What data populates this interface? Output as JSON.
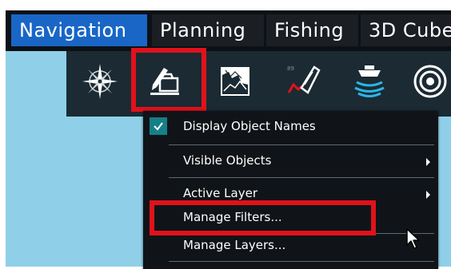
{
  "tabs": [
    {
      "label": "Navigation",
      "active": true
    },
    {
      "label": "Planning",
      "active": false
    },
    {
      "label": "Fishing",
      "active": false
    },
    {
      "label": "3D Cube",
      "active": false
    }
  ],
  "toolbar": {
    "tools": [
      {
        "icon": "compass-rose-icon",
        "highlighted": false
      },
      {
        "icon": "object-editor-icon",
        "highlighted": true
      },
      {
        "icon": "chart-map-icon",
        "highlighted": false
      },
      {
        "icon": "vessel-track-icon",
        "highlighted": false
      },
      {
        "icon": "sonar-boat-icon",
        "highlighted": false
      },
      {
        "icon": "radar-target-icon",
        "highlighted": false
      }
    ]
  },
  "menu": {
    "items": [
      {
        "label": "Display Object Names",
        "checked": true,
        "submenu": false
      },
      {
        "label": "Visible Objects",
        "checked": false,
        "submenu": true
      },
      {
        "label": "Active Layer",
        "checked": false,
        "submenu": true
      },
      {
        "label": "Manage Filters...",
        "checked": false,
        "submenu": false,
        "highlighted": true
      },
      {
        "label": "Manage Layers...",
        "checked": false,
        "submenu": false
      }
    ]
  },
  "colors": {
    "active_tab": "#1966c6",
    "tab_bg": "#1b1f24",
    "toolbar_bg": "#1b2a33",
    "menu_bg": "#101418",
    "map_water": "#8fd0e8",
    "highlight": "#e0121b",
    "check_bg": "#167f87"
  }
}
